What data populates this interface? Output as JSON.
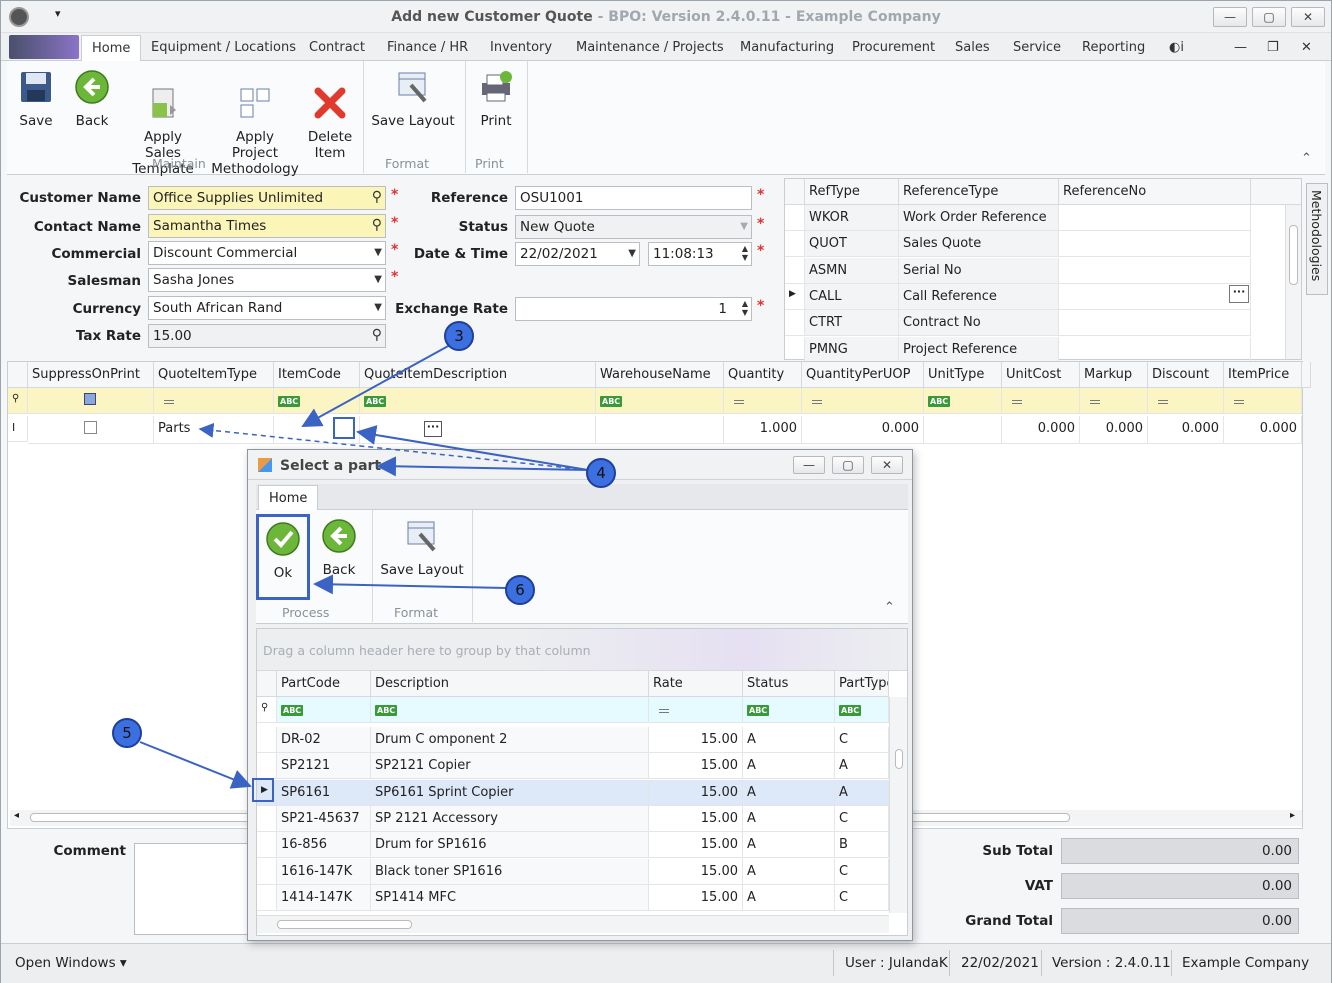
{
  "window": {
    "title": "Add new Customer Quote",
    "subtitle": " - BPO: Version 2.4.0.11 - Example Company",
    "minimize": "—",
    "maximize": "▢",
    "close": "✕"
  },
  "menu": {
    "tabs": [
      "Home",
      "Equipment / Locations",
      "Contract",
      "Finance / HR",
      "Inventory",
      "Maintenance / Projects",
      "Manufacturing",
      "Procurement",
      "Sales",
      "Service",
      "Reporting"
    ],
    "active": "Home"
  },
  "ribbon": {
    "save": "Save",
    "back": "Back",
    "apply_sales_template": "Apply Sales\nTemplate",
    "apply_project_methodology": "Apply Project\nMethodology",
    "delete_item": "Delete\nItem",
    "save_layout": "Save Layout",
    "print": "Print",
    "group_maintain": "Maintain",
    "group_format": "Format",
    "group_print": "Print"
  },
  "form": {
    "customer_name_label": "Customer Name",
    "customer_name": "Office Supplies Unlimited",
    "contact_name_label": "Contact Name",
    "contact_name": "Samantha Times",
    "commercial_label": "Commercial",
    "commercial": "Discount Commercial",
    "salesman_label": "Salesman",
    "salesman": "Sasha Jones",
    "currency_label": "Currency",
    "currency": "South African Rand",
    "tax_rate_label": "Tax Rate",
    "tax_rate": "15.00",
    "reference_label": "Reference",
    "reference": "OSU1001",
    "status_label": "Status",
    "status": "New Quote",
    "datetime_label": "Date & Time",
    "date": "22/02/2021",
    "time": "11:08:13",
    "exchange_rate_label": "Exchange Rate",
    "exchange_rate": "1"
  },
  "ref_grid": {
    "headers": [
      "RefType",
      "ReferenceType",
      "ReferenceNo"
    ],
    "rows": [
      [
        "WKOR",
        "Work Order Reference",
        ""
      ],
      [
        "QUOT",
        "Sales Quote",
        ""
      ],
      [
        "ASMN",
        "Serial No",
        ""
      ],
      [
        "CALL",
        "Call Reference",
        ""
      ],
      [
        "CTRT",
        "Contract No",
        ""
      ],
      [
        "PMNG",
        "Project Reference",
        ""
      ]
    ]
  },
  "side_tab": "Methodologies",
  "items_grid": {
    "headers": [
      "SuppressOnPrint",
      "QuoteItemType",
      "ItemCode",
      "QuoteItemDescription",
      "WarehouseName",
      "Quantity",
      "QuantityPerUOP",
      "UnitType",
      "UnitCost",
      "Markup",
      "Discount",
      "ItemPrice"
    ],
    "row": {
      "type": "Parts",
      "quantity": "1.000",
      "qty_per_uop": "0.000",
      "unit_cost": "0.000",
      "markup": "0.000",
      "discount": "0.000",
      "item_price": "0.000"
    }
  },
  "dialog": {
    "title": "Select a part",
    "tab": "Home",
    "ok": "Ok",
    "back": "Back",
    "save_layout": "Save Layout",
    "group_process": "Process",
    "group_format": "Format",
    "group_hint": "Drag a column header here to group by that column",
    "headers": [
      "PartCode",
      "Description",
      "Rate",
      "Status",
      "PartType"
    ],
    "rows": [
      [
        "DR-02",
        "Drum C omponent 2",
        "15.00",
        "A",
        "C"
      ],
      [
        "SP2121",
        "SP2121 Copier",
        "15.00",
        "A",
        "A"
      ],
      [
        "SP6161",
        "SP6161 Sprint Copier",
        "15.00",
        "A",
        "A"
      ],
      [
        "SP21-45637",
        "SP 2121 Accessory",
        "15.00",
        "A",
        "C"
      ],
      [
        "16-856",
        "Drum for SP1616",
        "15.00",
        "A",
        "B"
      ],
      [
        "1616-147K",
        "Black toner SP1616",
        "15.00",
        "A",
        "C"
      ],
      [
        "1414-147K",
        "SP1414 MFC",
        "15.00",
        "A",
        "C"
      ]
    ],
    "selected_index": 2
  },
  "comment_label": "Comment",
  "totals": {
    "sub_total_label": "Sub Total",
    "sub_total": "0.00",
    "vat_label": "VAT",
    "vat": "0.00",
    "grand_total_label": "Grand Total",
    "grand_total": "0.00"
  },
  "callouts": [
    "3",
    "4",
    "5",
    "6"
  ],
  "status_bar": {
    "open_windows": "Open Windows ▾",
    "user": "User : JulandaK",
    "date": "22/02/2021",
    "version": "Version : 2.4.0.11",
    "company": "Example Company"
  },
  "colors": {
    "callout": "#3c6fe0",
    "highlight_box": "#3b63c4",
    "filter_row": "#fbf5c4",
    "required_field": "#fcf5b8"
  }
}
